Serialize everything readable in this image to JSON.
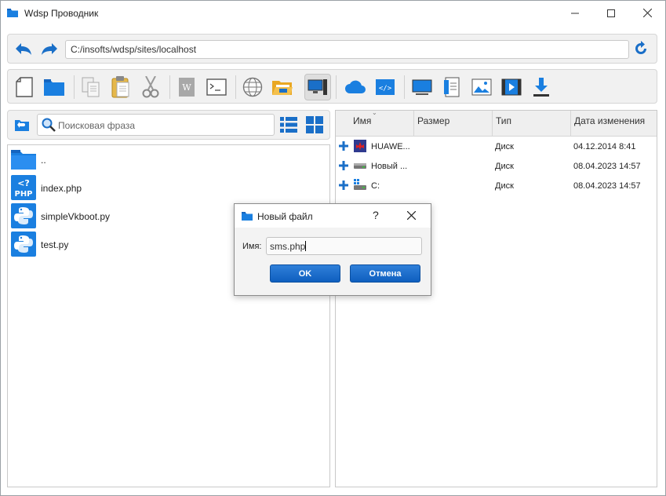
{
  "window": {
    "title": "Wdsp Проводник",
    "minimize_icon": "minimize-icon",
    "maximize_icon": "maximize-icon",
    "close_icon": "close-icon"
  },
  "address": {
    "path": "C:/insofts/wdsp/sites/localhost",
    "back_icon": "back-arrow-icon",
    "forward_icon": "forward-arrow-icon",
    "refresh_icon": "refresh-icon"
  },
  "toolbar": {
    "icons": [
      "new-file-icon",
      "new-folder-icon",
      "copy-icon",
      "paste-icon",
      "cut-icon",
      "archive-icon",
      "terminal-icon",
      "globe-icon",
      "open-folder-icon",
      "computer-icon",
      "cloud-icon",
      "code-icon",
      "monitor-icon",
      "document-icon",
      "image-icon",
      "video-icon",
      "download-icon"
    ]
  },
  "left": {
    "search_placeholder": "Поисковая фраза",
    "files": [
      {
        "name": "..",
        "icon": "folder-icon"
      },
      {
        "name": "index.php",
        "icon": "php-file-icon"
      },
      {
        "name": "simpleVkboot.py",
        "icon": "python-file-icon"
      },
      {
        "name": "test.py",
        "icon": "python-file-icon"
      }
    ]
  },
  "right": {
    "columns": [
      "Имя",
      "Размер",
      "Тип",
      "Дата изменения"
    ],
    "drives": [
      {
        "name": "HUAWE...",
        "size": "",
        "type": "Диск",
        "date": "04.12.2014 8:41"
      },
      {
        "name": "Новый ...",
        "size": "",
        "type": "Диск",
        "date": "08.04.2023 14:57"
      },
      {
        "name": "C:",
        "size": "",
        "type": "Диск",
        "date": "08.04.2023 14:57"
      }
    ]
  },
  "dialog": {
    "title": "Новый файл",
    "help": "?",
    "name_label": "Имя:",
    "name_value": "sms.php",
    "ok_label": "OK",
    "cancel_label": "Отмена"
  },
  "colors": {
    "accent": "#1a7fe0",
    "button": "#1466c8"
  }
}
